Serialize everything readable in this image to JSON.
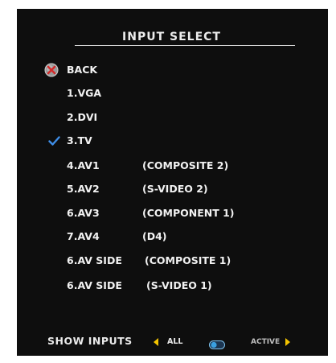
{
  "menu": {
    "title": "INPUT SELECT",
    "items": [
      {
        "label": "BACK",
        "sub": "",
        "icon": "back-icon"
      },
      {
        "label": "1.VGA",
        "sub": ""
      },
      {
        "label": "2.DVI",
        "sub": ""
      },
      {
        "label": "3.TV",
        "sub": "",
        "selected": true,
        "icon": "checkmark-icon"
      },
      {
        "label": "4.AV1",
        "sub": "(COMPOSITE 2)"
      },
      {
        "label": "5.AV2",
        "sub": "(S-VIDEO 2)"
      },
      {
        "label": "6.AV3",
        "sub": "(COMPONENT 1)"
      },
      {
        "label": "7.AV4",
        "sub": "(D4)"
      },
      {
        "label": "6.AV SIDE",
        "sub": "(COMPOSITE 1)"
      },
      {
        "label": "6.AV SIDE",
        "sub": "(S-VIDEO 1)"
      }
    ]
  },
  "footer": {
    "label": "SHOW INPUTS",
    "left_option": "ALL",
    "right_option": "ACTIVE"
  },
  "colors": {
    "background": "#0e0e0e",
    "text": "#f2f2f2",
    "accent_arrow": "#f4c400",
    "check": "#3f8ee8",
    "toggle": "#3aa0e0"
  }
}
